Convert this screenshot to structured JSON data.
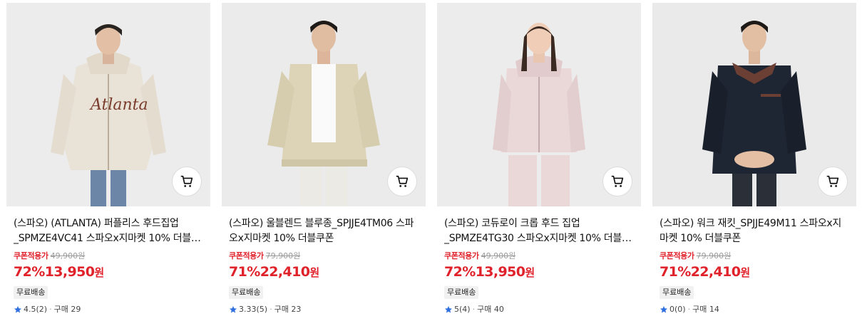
{
  "products": [
    {
      "title": "(스파오) (ATLANTA) 퍼플리스 후드집업_SPMZE4VC41 스파오x지마켓 10% 더블쿠폰",
      "coupon_label": "쿠폰적용가",
      "original_price": "49,900원",
      "discount": "72%",
      "price": "13,950",
      "currency": "원",
      "shipping": "무료배송",
      "rating": "4.5",
      "reviews": "(2)",
      "purchases": "구매 29",
      "image_desc": "model in cream fleece zip hoodie"
    },
    {
      "title": "(스파오) 울블렌드 블루종_SPJJE4TM06 스파오x지마켓 10% 더블쿠폰",
      "coupon_label": "쿠폰적용가",
      "original_price": "79,900원",
      "discount": "71%",
      "price": "22,410",
      "currency": "원",
      "shipping": "무료배송",
      "rating": "3.33",
      "reviews": "(5)",
      "purchases": "구매 23",
      "image_desc": "model in beige wool blouson"
    },
    {
      "title": "(스파오) 코듀로이 크롭 후드 집업_SPMZE4TG30 스파오x지마켓 10% 더블쿠폰",
      "coupon_label": "쿠폰적용가",
      "original_price": "49,900원",
      "discount": "72%",
      "price": "13,950",
      "currency": "원",
      "shipping": "무료배송",
      "rating": "5",
      "reviews": "(4)",
      "purchases": "구매 40",
      "image_desc": "model in pink corduroy cropped hoodie"
    },
    {
      "title": "(스파오) 워크 재킷_SPJJE49M11 스파오x지마켓 10% 더블쿠폰",
      "coupon_label": "쿠폰적용가",
      "original_price": "79,900원",
      "discount": "71%",
      "price": "22,410",
      "currency": "원",
      "shipping": "무료배송",
      "rating": "0",
      "reviews": "(0)",
      "purchases": "구매 14",
      "image_desc": "model in navy work jacket"
    }
  ],
  "colors": {
    "accent_red": "#e0222b",
    "star_blue": "#2f6fe0",
    "garments": [
      "#e9e2d7",
      "#ddd4b8",
      "#ead7d8",
      "#1f2633"
    ],
    "pants": [
      "#6c86a8",
      "#eceae4",
      "#ead8d9",
      "#2a2f38"
    ]
  },
  "icons": {
    "cart": "cart-icon",
    "star": "star-icon"
  }
}
